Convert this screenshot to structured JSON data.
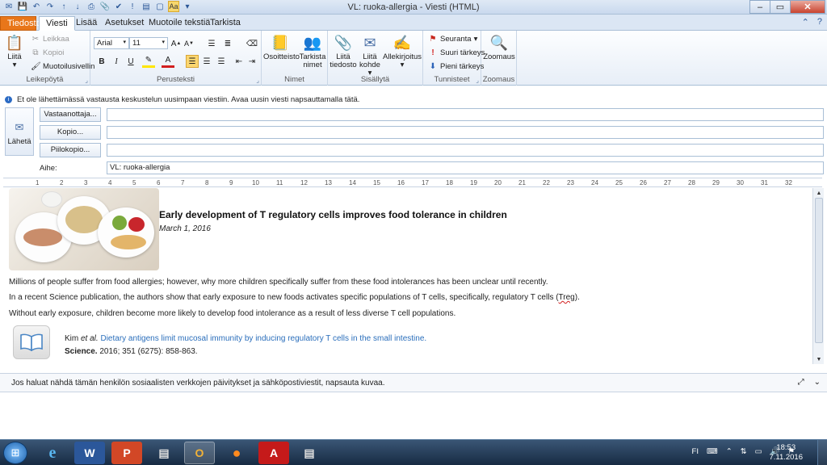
{
  "window": {
    "title": "VL: ruoka-allergia - Viesti (HTML)",
    "qat_highlight": "Aa"
  },
  "tabs": [
    {
      "label": "Tiedosto"
    },
    {
      "label": "Viesti"
    },
    {
      "label": "Lisää"
    },
    {
      "label": "Asetukset"
    },
    {
      "label": "Muotoile tekstiä"
    },
    {
      "label": "Tarkista"
    }
  ],
  "ribbon": {
    "clipboard": {
      "paste": "Liitä",
      "cut": "Leikkaa",
      "copy": "Kopioi",
      "format_painter": "Muotoilusivellin",
      "group": "Leikepöytä"
    },
    "basic_text": {
      "font_name": "Arial",
      "font_size": "11",
      "group": "Perusteksti"
    },
    "names": {
      "address_book": "Osoitteisto",
      "check_names_1": "Tarkista",
      "check_names_2": "nimet",
      "group": "Nimet"
    },
    "include": {
      "attach_file_1": "Liitä",
      "attach_file_2": "tiedosto",
      "attach_item_1": "Liitä",
      "attach_item_2": "kohde",
      "signature": "Allekirjoitus",
      "group": "Sisällytä"
    },
    "tags": {
      "follow_up": "Seuranta",
      "high_importance": "Suuri tärkeys",
      "low_importance": "Pieni tärkeys",
      "group": "Tunnisteet"
    },
    "zoom": {
      "zoom": "Zoomaus",
      "group": "Zoomaus"
    }
  },
  "infobar": {
    "text": "Et ole lähettämässä vastausta keskustelun uusimpaan viestiin. Avaa uusin viesti napsauttamalla tätä."
  },
  "compose": {
    "send": "Lähetä",
    "to_button": "Vastaanottaja...",
    "cc_button": "Kopio...",
    "bcc_button": "Piilokopio...",
    "to_value": "",
    "cc_value": "",
    "bcc_value": "",
    "subject_label": "Aihe:",
    "subject_value": "VL: ruoka-allergia"
  },
  "ruler": {
    "ticks": [
      "1",
      "2",
      "3",
      "4",
      "5",
      "6",
      "7",
      "8",
      "9",
      "10",
      "11",
      "12",
      "13",
      "14",
      "15",
      "16",
      "17",
      "18",
      "19",
      "20",
      "21",
      "22",
      "23",
      "24",
      "25",
      "26",
      "27",
      "28",
      "29",
      "30",
      "31",
      "32"
    ]
  },
  "message": {
    "article_title": "Early development of T regulatory cells improves food tolerance in children",
    "article_date": "March 1, 2016",
    "para1": "Millions of people suffer from food allergies; however, why more children specifically suffer from these food intolerances has been unclear until recently.",
    "para2_pre": "In a recent Science publication, the authors show that early exposure to new foods activates specific populations of T cells, specifically, regulatory T cells (",
    "para2_treg": "Treg",
    "para2_post": ").",
    "para3": "Without early exposure, children become more likely to develop food intolerance as a result of less diverse T cell populations.",
    "ref_author": "Kim ",
    "ref_etal": "et al.",
    "ref_link": "Dietary antigens limit mucosal immunity by inducing regulatory T cells in the small intestine.",
    "ref_journal": "Science.",
    "ref_details": " 2016; 351 (6275): 858-863."
  },
  "social": {
    "text": "Jos haluat nähdä tämän henkilön sosiaalisten verkkojen päivitykset ja sähköpostiviestit, napsauta kuvaa."
  },
  "taskbar": {
    "lang": "FI",
    "time": "18:53",
    "date": "7.11.2016"
  }
}
